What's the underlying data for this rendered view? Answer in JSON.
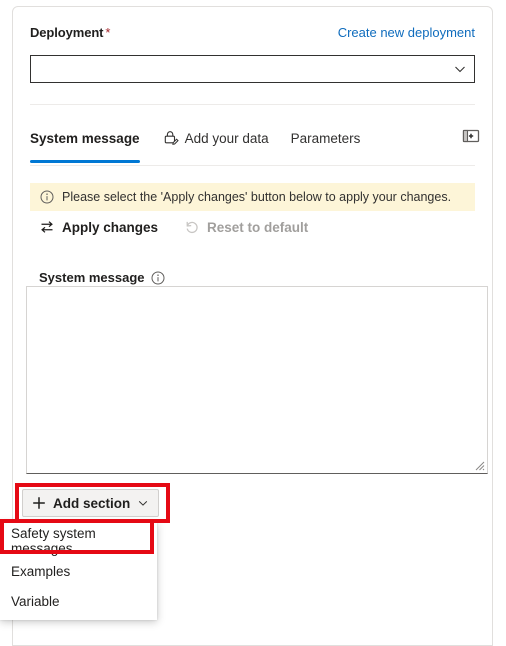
{
  "panel": {
    "deployment": {
      "label": "Deployment",
      "required_marker": "*",
      "create_link": "Create new deployment",
      "select_value": "",
      "select_placeholder": "",
      "chevron_icon": "chevron-down-icon"
    },
    "tabs": [
      {
        "label": "System message",
        "active": true,
        "icon": null
      },
      {
        "label": "Add your data",
        "active": false,
        "icon": "lock-edit-icon"
      },
      {
        "label": "Parameters",
        "active": false,
        "icon": null
      }
    ],
    "collapse_panel_icon": "panel-collapse-icon",
    "infobar": {
      "icon": "info-circle-icon",
      "text": "Please select the 'Apply changes' button below to apply your changes."
    },
    "commands": [
      {
        "label": "Apply changes",
        "icon": "two-way-arrows-icon",
        "disabled": false
      },
      {
        "label": "Reset to default",
        "icon": "undo-arrow-icon",
        "disabled": true
      }
    ],
    "system_message": {
      "label": "System message",
      "help_icon": "info-circle-icon",
      "value": "",
      "placeholder": ""
    },
    "add_section": {
      "label": "Add section",
      "plus_icon": "plus-icon",
      "chevron_icon": "chevron-down-icon"
    },
    "menu_items": [
      {
        "label": "Safety system messages"
      },
      {
        "label": "Examples"
      },
      {
        "label": "Variable"
      }
    ]
  },
  "colors": {
    "accent_blue": "#0078d4",
    "link_blue": "#0f6cbd",
    "required_red": "#a4262c",
    "infobar_bg": "#fdf5d8",
    "annotation_red": "#e50914",
    "button_bg": "#f3f2f1",
    "text_primary": "#201f1e",
    "text_disabled": "#a19f9d",
    "border_grey": "#e1dfdd"
  }
}
